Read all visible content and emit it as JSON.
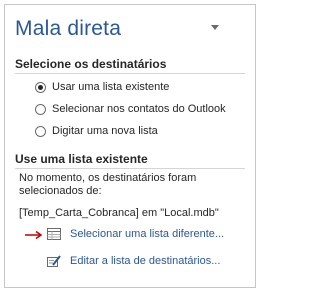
{
  "pane": {
    "title": "Mala direta",
    "menu_icon": "chevron-down-icon"
  },
  "recipients_section": {
    "heading": "Selecione os destinatários",
    "options": [
      {
        "label": "Usar uma lista existente",
        "selected": true
      },
      {
        "label": "Selecionar nos contatos do Outlook",
        "selected": false
      },
      {
        "label": "Digitar uma nova lista",
        "selected": false
      }
    ]
  },
  "existing_list_section": {
    "heading": "Use uma lista existente",
    "description_line1": "No momento, os destinatários foram",
    "description_line2": "selecionados de:",
    "source": "[Temp_Carta_Cobranca] em \"Local.mdb\"",
    "select_link": "Selecionar uma lista diferente...",
    "edit_link": "Editar a lista de destinatários...",
    "select_icon": "table-icon",
    "edit_icon": "edit-list-icon",
    "annotation_icon": "red-arrow-icon"
  },
  "colors": {
    "accent": "#2b579a",
    "text": "#262626",
    "annotation": "#c00000"
  }
}
